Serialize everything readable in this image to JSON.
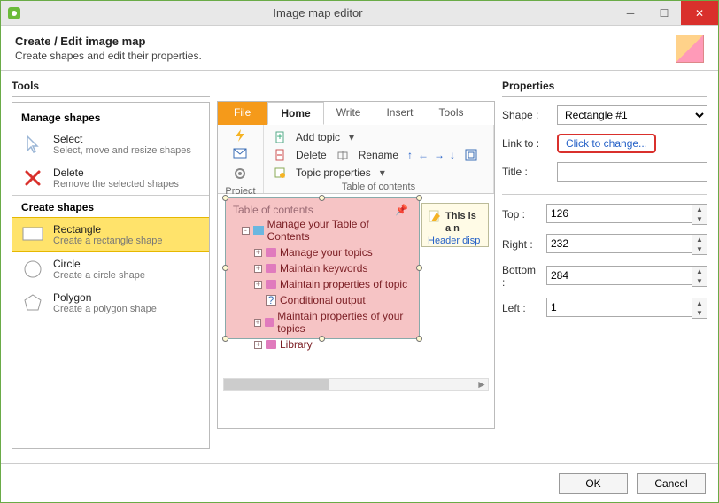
{
  "window": {
    "title": "Image map editor"
  },
  "header": {
    "title": "Create / Edit image map",
    "subtitle": "Create shapes and edit their properties."
  },
  "sections": {
    "tools": "Tools",
    "properties": "Properties"
  },
  "tools": {
    "group_manage": "Manage shapes",
    "group_create": "Create shapes",
    "select": {
      "name": "Select",
      "desc": "Select, move and resize shapes"
    },
    "delete": {
      "name": "Delete",
      "desc": "Remove the selected shapes"
    },
    "rectangle": {
      "name": "Rectangle",
      "desc": "Create a rectangle shape"
    },
    "circle": {
      "name": "Circle",
      "desc": "Create a circle shape"
    },
    "polygon": {
      "name": "Polygon",
      "desc": "Create a polygon shape"
    }
  },
  "ribbon": {
    "tabs": {
      "file": "File",
      "home": "Home",
      "write": "Write",
      "insert": "Insert",
      "tools": "Tools"
    },
    "groups": {
      "project": "Project",
      "toc": "Table of contents"
    },
    "cmds": {
      "add_topic": "Add topic",
      "delete": "Delete",
      "rename": "Rename",
      "topic_props": "Topic properties"
    }
  },
  "toc": {
    "header": "Table of contents",
    "root": "Manage your Table of Contents",
    "items": [
      "Manage your topics",
      "Maintain keywords",
      "Maintain properties of topic",
      "Conditional output",
      "Maintain properties of your topics",
      "Library"
    ]
  },
  "note": {
    "title": "This is a n",
    "link": "Header disp"
  },
  "props": {
    "labels": {
      "shape": "Shape :",
      "link_to": "Link to :",
      "title": "Title :",
      "top": "Top :",
      "right": "Right :",
      "bottom": "Bottom :",
      "left": "Left :"
    },
    "shape_value": "Rectangle #1",
    "link_to_text": "Click to change...",
    "title_value": "",
    "top": "126",
    "right": "232",
    "bottom": "284",
    "left": "1"
  },
  "footer": {
    "ok": "OK",
    "cancel": "Cancel"
  }
}
